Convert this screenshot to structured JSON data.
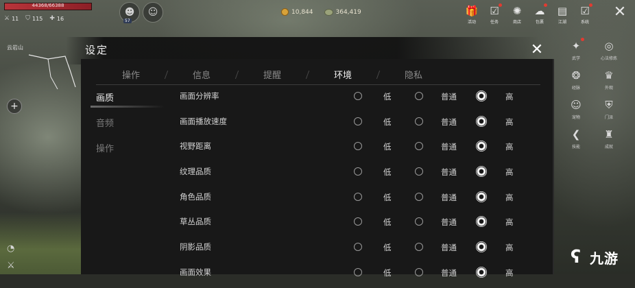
{
  "hud": {
    "hp_text": "44368/66388",
    "stats": [
      {
        "icon": "sword-icon",
        "value": "11"
      },
      {
        "icon": "shield-icon",
        "value": "115"
      },
      {
        "icon": "plus-icon",
        "value": "16"
      }
    ],
    "avatar_badge": "57",
    "currency": [
      {
        "icon": "gold-coin-icon",
        "value": "10,844"
      },
      {
        "icon": "jade-icon",
        "value": "364,419"
      }
    ],
    "map_label": "云岩山"
  },
  "top_menu": [
    {
      "name": "gift",
      "label": "活动",
      "glyph": "🎁",
      "dot": false
    },
    {
      "name": "checklist",
      "label": "任务",
      "glyph": "☑",
      "dot": true
    },
    {
      "name": "shop",
      "label": "商店",
      "glyph": "✺",
      "dot": false
    },
    {
      "name": "bag",
      "label": "包裹",
      "glyph": "☁",
      "dot": true
    },
    {
      "name": "book",
      "label": "江湖",
      "glyph": "▤",
      "dot": false
    },
    {
      "name": "quest",
      "label": "系统",
      "glyph": "☑",
      "dot": true
    }
  ],
  "side_menu": [
    {
      "name": "martial",
      "label": "武学",
      "glyph": "✦",
      "dot": true
    },
    {
      "name": "mind",
      "label": "心法修炼",
      "glyph": "◎",
      "dot": false
    },
    {
      "name": "meridian",
      "label": "经脉",
      "glyph": "❂",
      "dot": false
    },
    {
      "name": "outfit",
      "label": "外观",
      "glyph": "♛",
      "dot": false
    },
    {
      "name": "pet",
      "label": "宠物",
      "glyph": "☺",
      "dot": false
    },
    {
      "name": "guild",
      "label": "门派",
      "glyph": "⛨",
      "dot": false
    },
    {
      "name": "skill",
      "label": "技能",
      "glyph": "❮",
      "dot": false
    },
    {
      "name": "achievement",
      "label": "成就",
      "glyph": "♜",
      "dot": false
    }
  ],
  "dialog": {
    "title": "设定",
    "tabs": [
      "操作",
      "信息",
      "提醒",
      "环境",
      "隐私"
    ],
    "active_tab": "环境",
    "nav": [
      "画质",
      "音频",
      "操作"
    ],
    "active_nav": "画质",
    "options": {
      "low": "低",
      "mid": "普通",
      "high": "高"
    },
    "rows": [
      {
        "label": "画面分辨率",
        "selected": "high"
      },
      {
        "label": "画面播放速度",
        "selected": "high"
      },
      {
        "label": "视野距离",
        "selected": "high"
      },
      {
        "label": "纹理品质",
        "selected": "high"
      },
      {
        "label": "角色品质",
        "selected": "high"
      },
      {
        "label": "草丛品质",
        "selected": "high"
      },
      {
        "label": "阴影品质",
        "selected": "high"
      },
      {
        "label": "画面效果",
        "selected": "high"
      }
    ]
  },
  "watermark": {
    "text": "九游"
  }
}
